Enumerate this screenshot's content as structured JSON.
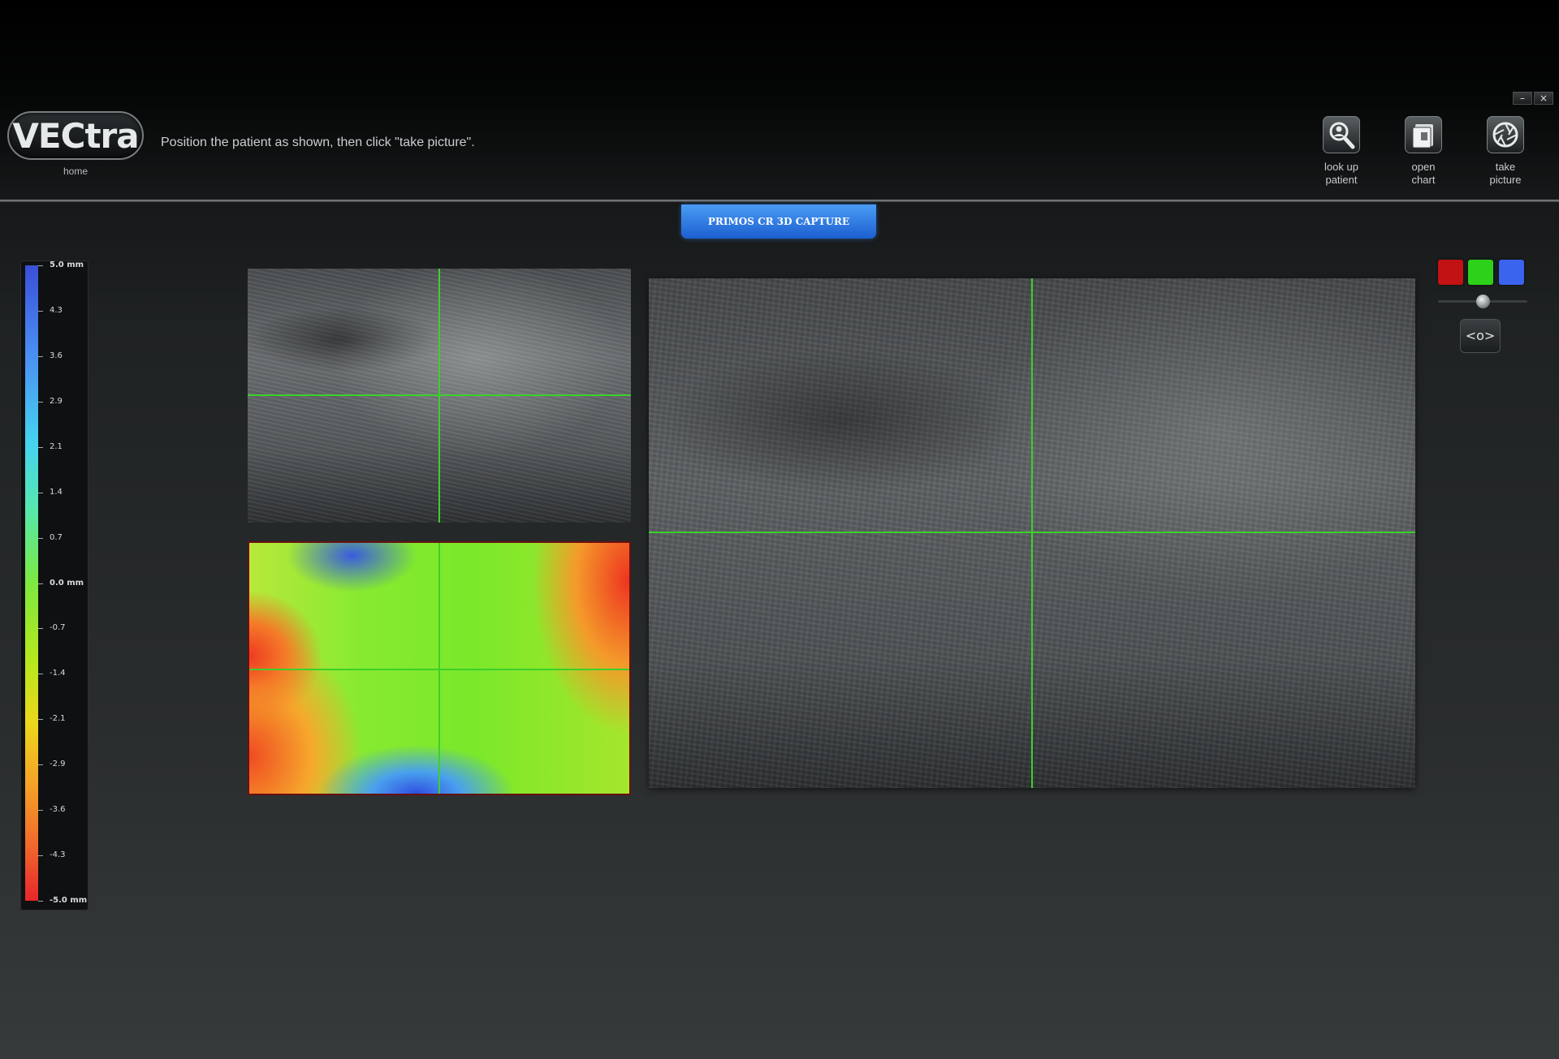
{
  "window": {
    "minimize": "–",
    "close": "×"
  },
  "header": {
    "logo_text": "VECtra",
    "home_label": "home",
    "instruction": "Position the patient as shown, then click \"take picture\".",
    "tools": [
      {
        "icon": "magnifier-person-icon",
        "line1": "look up",
        "line2": "patient"
      },
      {
        "icon": "chart-folder-icon",
        "line1": "open",
        "line2": "chart"
      },
      {
        "icon": "camera-shutter-icon",
        "line1": "take",
        "line2": "picture"
      }
    ]
  },
  "mode_tab": "PRIMOS CR 3D CAPTURE",
  "color_scale": {
    "unit": "mm",
    "labels": [
      "5.0 mm",
      "4.3",
      "3.6",
      "2.9",
      "2.1",
      "1.4",
      "0.7",
      "0.0 mm",
      "-0.7",
      "-1.4",
      "-2.1",
      "-2.9",
      "-3.6",
      "-4.3",
      "-5.0 mm"
    ],
    "colors": {
      "max": "#3a4fd8",
      "zero": "#7de840",
      "min": "#e8262a"
    }
  },
  "channels": {
    "red": "#c31214",
    "green": "#2ed11a",
    "blue": "#3a63ee"
  },
  "view_toggle": "<o>",
  "crosshair_color": "#3cd02c"
}
